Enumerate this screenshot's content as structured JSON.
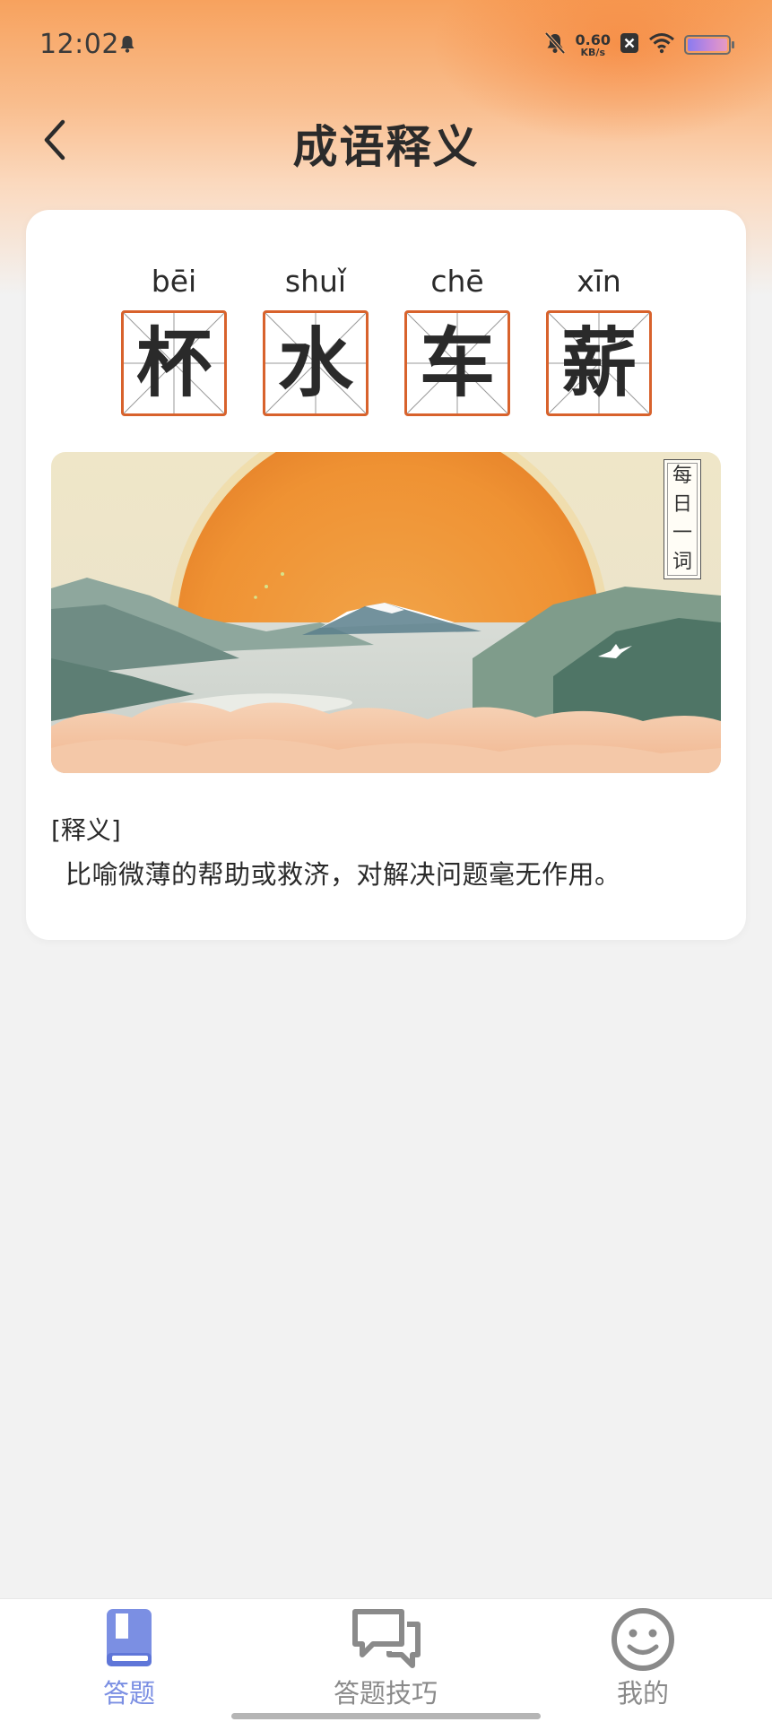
{
  "status_bar": {
    "time": "12:02",
    "net_speed_value": "0.60",
    "net_speed_unit": "KB/s"
  },
  "header": {
    "title": "成语释义"
  },
  "idiom": {
    "characters": [
      {
        "char": "杯",
        "pinyin": "bēi"
      },
      {
        "char": "水",
        "pinyin": "shuǐ"
      },
      {
        "char": "车",
        "pinyin": "chē"
      },
      {
        "char": "薪",
        "pinyin": "xīn"
      }
    ]
  },
  "illustration": {
    "tag": [
      "每",
      "日",
      "一",
      "词"
    ]
  },
  "definition": {
    "label": "[释义]",
    "text": "比喻微薄的帮助或救济，对解决问题毫无作用。"
  },
  "bottom_nav": {
    "items": [
      {
        "label": "答题",
        "icon": "book-icon",
        "active": true
      },
      {
        "label": "答题技巧",
        "icon": "chat-bubbles-icon",
        "active": false
      },
      {
        "label": "我的",
        "icon": "smiley-icon",
        "active": false
      }
    ]
  },
  "colors": {
    "accent_orange": "#d8622c",
    "nav_active": "#7b8fe3",
    "nav_inactive": "#8a8a8a",
    "header_gradient_top": "#f7a25e"
  }
}
